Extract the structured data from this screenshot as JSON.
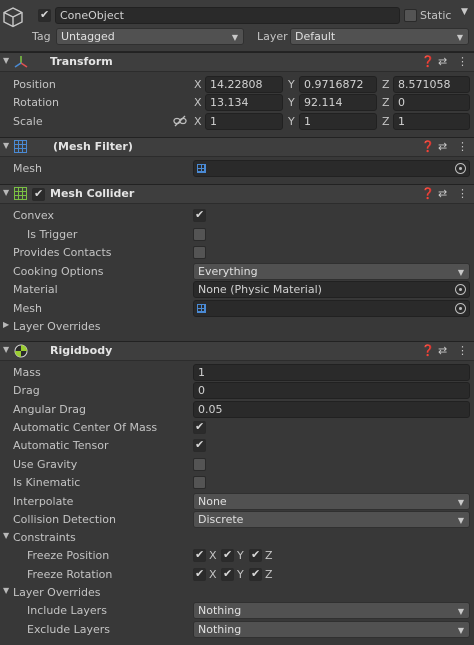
{
  "header": {
    "object_name": "ConeObject",
    "static_label": "Static",
    "tag_label": "Tag",
    "tag_value": "Untagged",
    "layer_label": "Layer",
    "layer_value": "Default"
  },
  "transform": {
    "title": "Transform",
    "rows": [
      {
        "label": "Position",
        "x": "14.22808",
        "y": "0.9716872",
        "z": "8.571058"
      },
      {
        "label": "Rotation",
        "x": "13.134",
        "y": "92.114",
        "z": "0"
      },
      {
        "label": "Scale",
        "x": "1",
        "y": "1",
        "z": "1"
      }
    ],
    "axis_x": "X",
    "axis_y": "Y",
    "axis_z": "Z"
  },
  "mesh_filter": {
    "title": "(Mesh Filter)",
    "mesh_label": "Mesh"
  },
  "mesh_collider": {
    "title": "Mesh Collider",
    "convex": "Convex",
    "is_trigger": "Is Trigger",
    "provides_contacts": "Provides Contacts",
    "cooking_options": "Cooking Options",
    "cooking_value": "Everything",
    "material": "Material",
    "material_value": "None (Physic Material)",
    "mesh": "Mesh",
    "layer_overrides": "Layer Overrides"
  },
  "rigidbody": {
    "title": "Rigidbody",
    "mass": "Mass",
    "mass_value": "1",
    "drag": "Drag",
    "drag_value": "0",
    "angular_drag": "Angular Drag",
    "angular_drag_value": "0.05",
    "auto_com": "Automatic Center Of Mass",
    "auto_tensor": "Automatic Tensor",
    "use_gravity": "Use Gravity",
    "is_kinematic": "Is Kinematic",
    "interpolate": "Interpolate",
    "interpolate_value": "None",
    "collision_detection": "Collision Detection",
    "collision_value": "Discrete",
    "constraints": "Constraints",
    "freeze_position": "Freeze Position",
    "freeze_rotation": "Freeze Rotation",
    "layer_overrides": "Layer Overrides",
    "include_layers": "Include Layers",
    "include_value": "Nothing",
    "exclude_layers": "Exclude Layers",
    "exclude_value": "Nothing"
  },
  "colors": {
    "background": "#383838",
    "field": "#2a2a2a",
    "dropdown": "#515151",
    "accent_blue": "#4a8ad4",
    "accent_green": "#7ac143"
  },
  "icons": [
    "cube-icon",
    "transform-axes-icon",
    "mesh-filter-grid-icon",
    "mesh-collider-grid-icon",
    "rigidbody-sphere-icon",
    "help-icon",
    "presets-icon",
    "more-icon",
    "link-icon",
    "object-picker-icon"
  ]
}
